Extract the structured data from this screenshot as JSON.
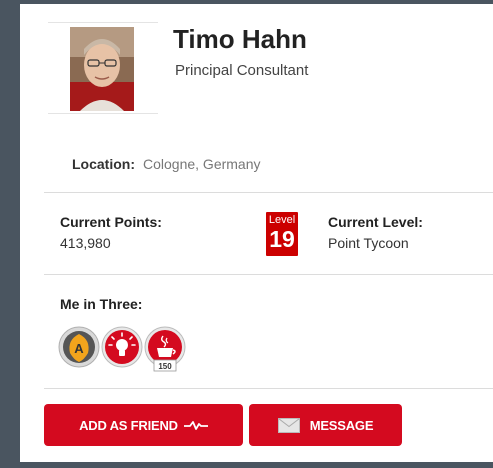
{
  "profile": {
    "name": "Timo Hahn",
    "title": "Principal Consultant",
    "avatar_icon": "user-photo"
  },
  "location": {
    "label": "Location:",
    "value": "Cologne, Germany"
  },
  "points": {
    "label": "Current Points:",
    "value": "413,980"
  },
  "level": {
    "badge_word": "Level",
    "badge_number": "19",
    "label": "Current Level:",
    "value": "Point Tycoon"
  },
  "me_in_three": {
    "label": "Me in Three:",
    "badges": [
      {
        "icon": "acorn-badge-icon",
        "letter": "A"
      },
      {
        "icon": "lightbulb-badge-icon"
      },
      {
        "icon": "java-badge-icon",
        "caption": "150"
      }
    ]
  },
  "actions": {
    "add_friend_label": "ADD AS FRIEND",
    "message_label": "MESSAGE"
  },
  "colors": {
    "accent": "#d40a1f",
    "frame": "#4a5560"
  }
}
